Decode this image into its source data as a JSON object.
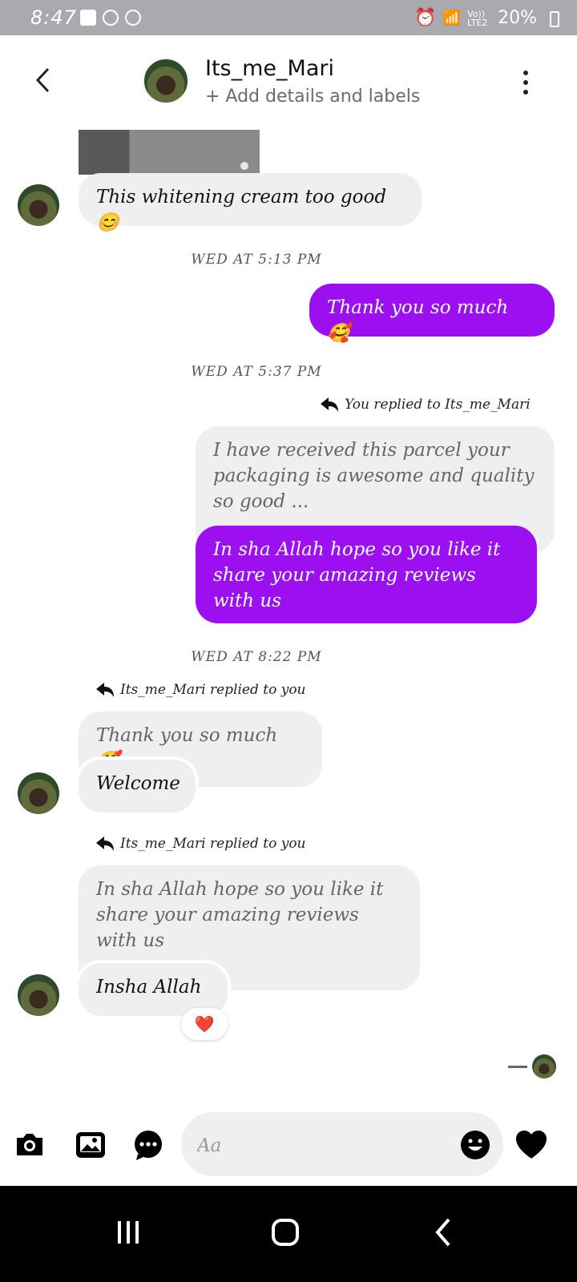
{
  "status_bar": {
    "time": "8:47",
    "network": "Vo)) LTE2",
    "battery": "20%"
  },
  "header": {
    "name": "Its_me_Mari",
    "subtitle": "+ Add details and labels"
  },
  "messages": {
    "m1_text": "This whitening cream too good😊",
    "ts1": "WED AT 5:13 PM",
    "m2_text": "Thank you so much 🥰",
    "ts2": "WED AT 5:37 PM",
    "reply_note_1": "You replied to Its_me_Mari",
    "m3_quote": "I have received this parcel your packaging is awesome and quality so good ...",
    "m3_text": "In sha Allah hope so you like it share your amazing reviews with us",
    "ts3": "WED AT 8:22 PM",
    "reply_note_2": "Its_me_Mari replied to you",
    "m4_quote": "Thank you so much 🥰",
    "m4_text": "Welcome",
    "reply_note_3": "Its_me_Mari replied to you",
    "m5_quote": "In sha Allah hope so you like it share your amazing reviews with us",
    "m5_text": "Insha Allah",
    "m5_reaction": "❤️"
  },
  "composer": {
    "placeholder": "Aa"
  },
  "colors": {
    "accent": "#9b0ff1",
    "bubble_in": "#efeff2",
    "status_bar": "#a9aaae"
  },
  "icons": [
    "back-icon",
    "more-icon",
    "camera-icon",
    "gallery-icon",
    "chat-icon",
    "emoji-icon",
    "heart-icon",
    "reply-icon"
  ]
}
